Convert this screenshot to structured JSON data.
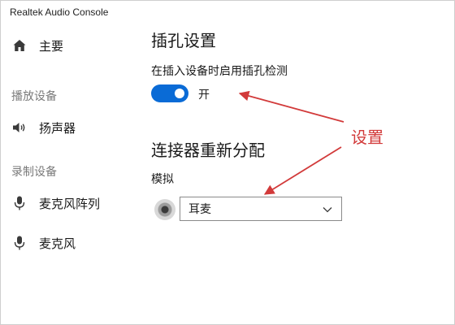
{
  "app": {
    "title": "Realtek Audio Console"
  },
  "sidebar": {
    "home": {
      "label": "主要",
      "icon": "home-icon"
    },
    "playback_section": "播放设备",
    "playback_items": [
      {
        "label": "扬声器",
        "icon": "speaker-icon"
      }
    ],
    "recording_section": "录制设备",
    "recording_items": [
      {
        "label": "麦克风阵列",
        "icon": "microphone-icon"
      },
      {
        "label": "麦克风",
        "icon": "microphone-icon"
      }
    ]
  },
  "main": {
    "jack_settings_title": "插孔设置",
    "jack_detect_label": "在插入设备时启用插孔检测",
    "toggle": {
      "state": "on",
      "label": "开"
    },
    "reassign_title": "连接器重新分配",
    "analog_label": "模拟",
    "dropdown": {
      "selected": "耳麦"
    }
  },
  "annotation": {
    "text": "设置",
    "color": "#d23a3a"
  },
  "colors": {
    "accent": "#0a6bd6",
    "annotation": "#d23a3a"
  }
}
